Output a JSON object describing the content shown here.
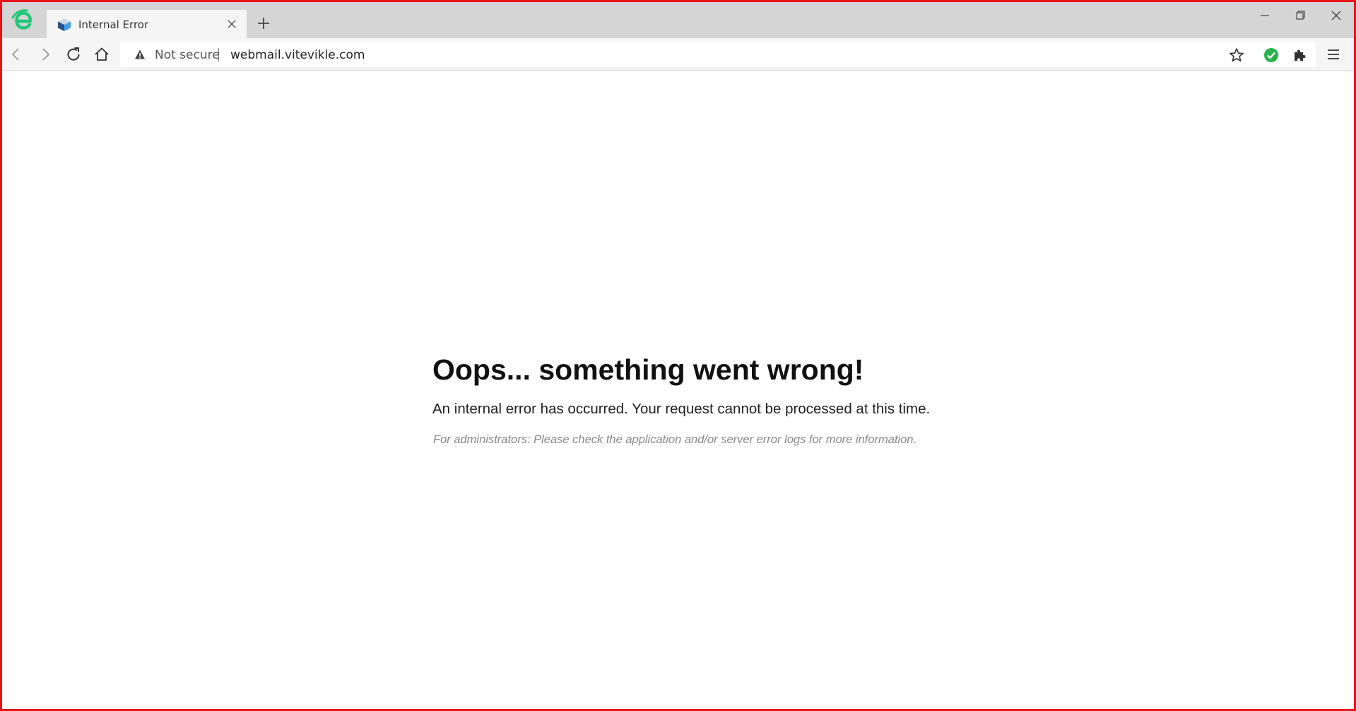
{
  "browser": {
    "tab": {
      "title": "Internal Error",
      "favicon": "cube-favicon-icon"
    },
    "address_bar": {
      "security_label": "Not secure",
      "url": "webmail.vitevikle.com"
    },
    "icons": {
      "app_logo": "browser-logo-icon",
      "bookmark": "star-icon",
      "verified": "green-check-icon",
      "extensions": "puzzle-icon",
      "menu": "hamburger-menu-icon"
    },
    "colors": {
      "frame": "#e8141a",
      "logo": "#21c77a",
      "check": "#27b34a"
    }
  },
  "page": {
    "heading": "Oops... something went wrong!",
    "message": "An internal error has occurred. Your request cannot be processed at this time.",
    "admin_note": "For administrators: Please check the application and/or server error logs for more information."
  }
}
